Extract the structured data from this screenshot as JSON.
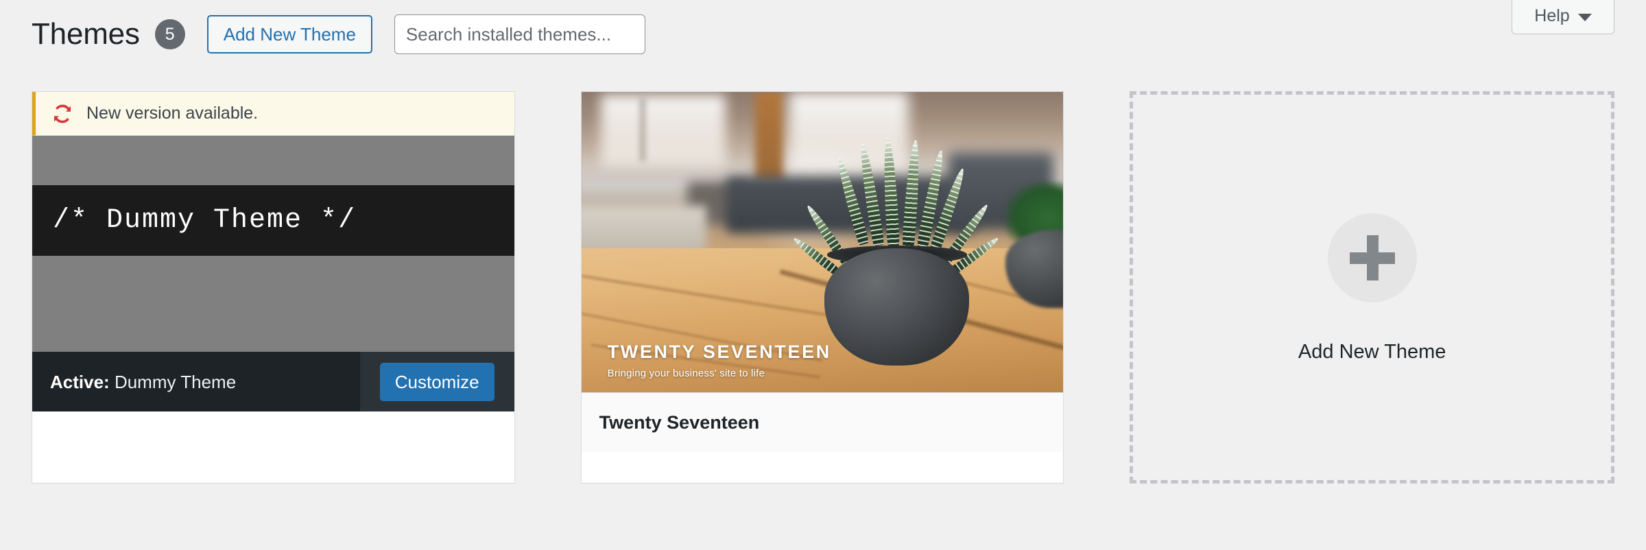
{
  "header": {
    "title": "Themes",
    "theme_count": "5",
    "add_new_button": "Add New Theme",
    "search": {
      "placeholder": "Search installed themes...",
      "value": ""
    },
    "help_tab": {
      "label": "Help",
      "icon": "chevron-down-icon"
    }
  },
  "themes": [
    {
      "id": "dummy-theme",
      "name": "Dummy Theme",
      "active_prefix": "Active:",
      "update_notice": {
        "text": "New version available.",
        "icon": "update-icon",
        "accent_color": "#dba617",
        "background_color": "#fcf9e8"
      },
      "screenshot_text": "/* Dummy Theme */",
      "customize_button": "Customize",
      "is_active": true
    },
    {
      "id": "twentyseventeen",
      "name": "Twenty Seventeen",
      "screenshot_brand": "TWENTY SEVENTEEN",
      "screenshot_tagline": "Bringing your business' site to life",
      "is_active": false
    }
  ],
  "add_new_card": {
    "label": "Add New Theme",
    "icon": "plus-icon"
  },
  "colors": {
    "page_background": "#f0f0f1",
    "accent_blue": "#2271b1",
    "dark_footer": "#1d2327",
    "dark_footer_actions": "#2c3338",
    "badge_gray": "#646970",
    "notice_yellow": "#dba617",
    "dashed_border": "#c3c4c7"
  }
}
